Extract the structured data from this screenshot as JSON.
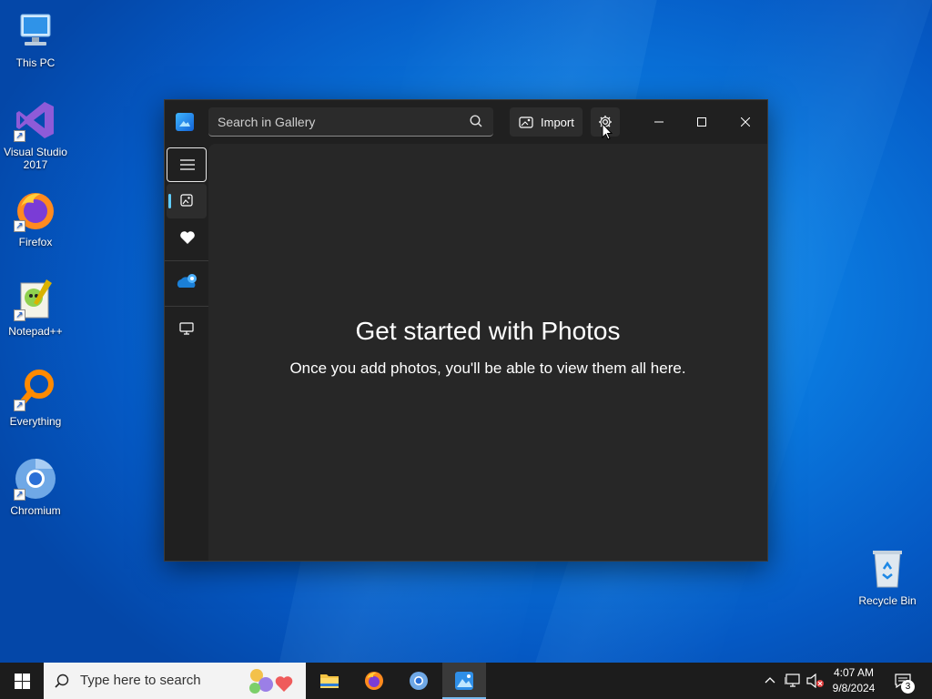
{
  "desktop": {
    "icons": [
      {
        "label": "This PC"
      },
      {
        "label": "Visual Studio 2017"
      },
      {
        "label": "Firefox"
      },
      {
        "label": "Notepad++"
      },
      {
        "label": "Everything"
      },
      {
        "label": "Chromium"
      },
      {
        "label": "Recycle Bin"
      }
    ]
  },
  "window": {
    "search_placeholder": "Search in Gallery",
    "import_label": "Import",
    "empty_title": "Get started with Photos",
    "empty_subtitle": "Once you add photos, you'll be able to view them all here."
  },
  "taskbar": {
    "search_placeholder": "Type here to search",
    "time": "4:07 AM",
    "date": "9/8/2024",
    "notification_count": "3"
  },
  "colors": {
    "accent": "#60cdff",
    "window_bg": "#202020",
    "content_bg": "#272727",
    "taskbar_bg": "#1c1c1c"
  }
}
